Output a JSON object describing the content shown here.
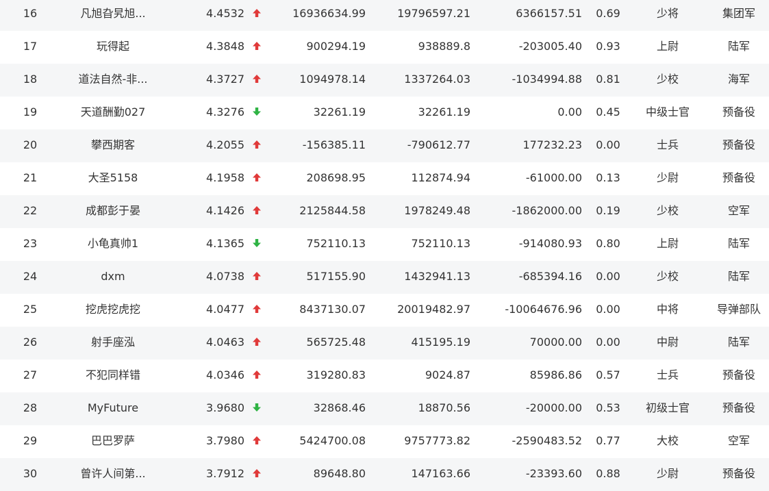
{
  "colors": {
    "up": "#e03a3a",
    "down": "#2fb344",
    "stripe": "#f5f6f7"
  },
  "rows": [
    {
      "rank": "16",
      "name": "凡旭旮旯旭...",
      "score": "4.4532",
      "trend": "up",
      "v1": "16936634.99",
      "v2": "19796597.21",
      "v3": "6366157.51",
      "ratio": "0.69",
      "title": "少将",
      "branch": "集团军"
    },
    {
      "rank": "17",
      "name": "玩得起",
      "score": "4.3848",
      "trend": "up",
      "v1": "900294.19",
      "v2": "938889.8",
      "v3": "-203005.40",
      "ratio": "0.93",
      "title": "上尉",
      "branch": "陆军"
    },
    {
      "rank": "18",
      "name": "道法自然-非...",
      "score": "4.3727",
      "trend": "up",
      "v1": "1094978.14",
      "v2": "1337264.03",
      "v3": "-1034994.88",
      "ratio": "0.81",
      "title": "少校",
      "branch": "海军"
    },
    {
      "rank": "19",
      "name": "天道酬勤027",
      "score": "4.3276",
      "trend": "down",
      "v1": "32261.19",
      "v2": "32261.19",
      "v3": "0.00",
      "ratio": "0.45",
      "title": "中级士官",
      "branch": "预备役"
    },
    {
      "rank": "20",
      "name": "攀西期客",
      "score": "4.2055",
      "trend": "up",
      "v1": "-156385.11",
      "v2": "-790612.77",
      "v3": "177232.23",
      "ratio": "0.00",
      "title": "士兵",
      "branch": "预备役"
    },
    {
      "rank": "21",
      "name": "大圣5158",
      "score": "4.1958",
      "trend": "up",
      "v1": "208698.95",
      "v2": "112874.94",
      "v3": "-61000.00",
      "ratio": "0.13",
      "title": "少尉",
      "branch": "预备役"
    },
    {
      "rank": "22",
      "name": "成都彭于晏",
      "score": "4.1426",
      "trend": "up",
      "v1": "2125844.58",
      "v2": "1978249.48",
      "v3": "-1862000.00",
      "ratio": "0.19",
      "title": "少校",
      "branch": "空军"
    },
    {
      "rank": "23",
      "name": "小龟真帅1",
      "score": "4.1365",
      "trend": "down",
      "v1": "752110.13",
      "v2": "752110.13",
      "v3": "-914080.93",
      "ratio": "0.80",
      "title": "上尉",
      "branch": "陆军"
    },
    {
      "rank": "24",
      "name": "dxm",
      "score": "4.0738",
      "trend": "up",
      "v1": "517155.90",
      "v2": "1432941.13",
      "v3": "-685394.16",
      "ratio": "0.00",
      "title": "少校",
      "branch": "陆军"
    },
    {
      "rank": "25",
      "name": "挖虎挖虎挖",
      "score": "4.0477",
      "trend": "up",
      "v1": "8437130.07",
      "v2": "20019482.97",
      "v3": "-10064676.96",
      "ratio": "0.00",
      "title": "中将",
      "branch": "导弹部队"
    },
    {
      "rank": "26",
      "name": "射手座泓",
      "score": "4.0463",
      "trend": "up",
      "v1": "565725.48",
      "v2": "415195.19",
      "v3": "70000.00",
      "ratio": "0.00",
      "title": "中尉",
      "branch": "陆军"
    },
    {
      "rank": "27",
      "name": "不犯同样错",
      "score": "4.0346",
      "trend": "up",
      "v1": "319280.83",
      "v2": "9024.87",
      "v3": "85986.86",
      "ratio": "0.57",
      "title": "士兵",
      "branch": "预备役"
    },
    {
      "rank": "28",
      "name": "MyFuture",
      "score": "3.9680",
      "trend": "down",
      "v1": "32868.46",
      "v2": "18870.56",
      "v3": "-20000.00",
      "ratio": "0.53",
      "title": "初级士官",
      "branch": "预备役"
    },
    {
      "rank": "29",
      "name": "巴巴罗萨",
      "score": "3.7980",
      "trend": "up",
      "v1": "5424700.08",
      "v2": "9757773.82",
      "v3": "-2590483.52",
      "ratio": "0.77",
      "title": "大校",
      "branch": "空军"
    },
    {
      "rank": "30",
      "name": "曾许人间第...",
      "score": "3.7912",
      "trend": "up",
      "v1": "89648.80",
      "v2": "147163.66",
      "v3": "-23393.60",
      "ratio": "0.88",
      "title": "少尉",
      "branch": "预备役"
    }
  ]
}
